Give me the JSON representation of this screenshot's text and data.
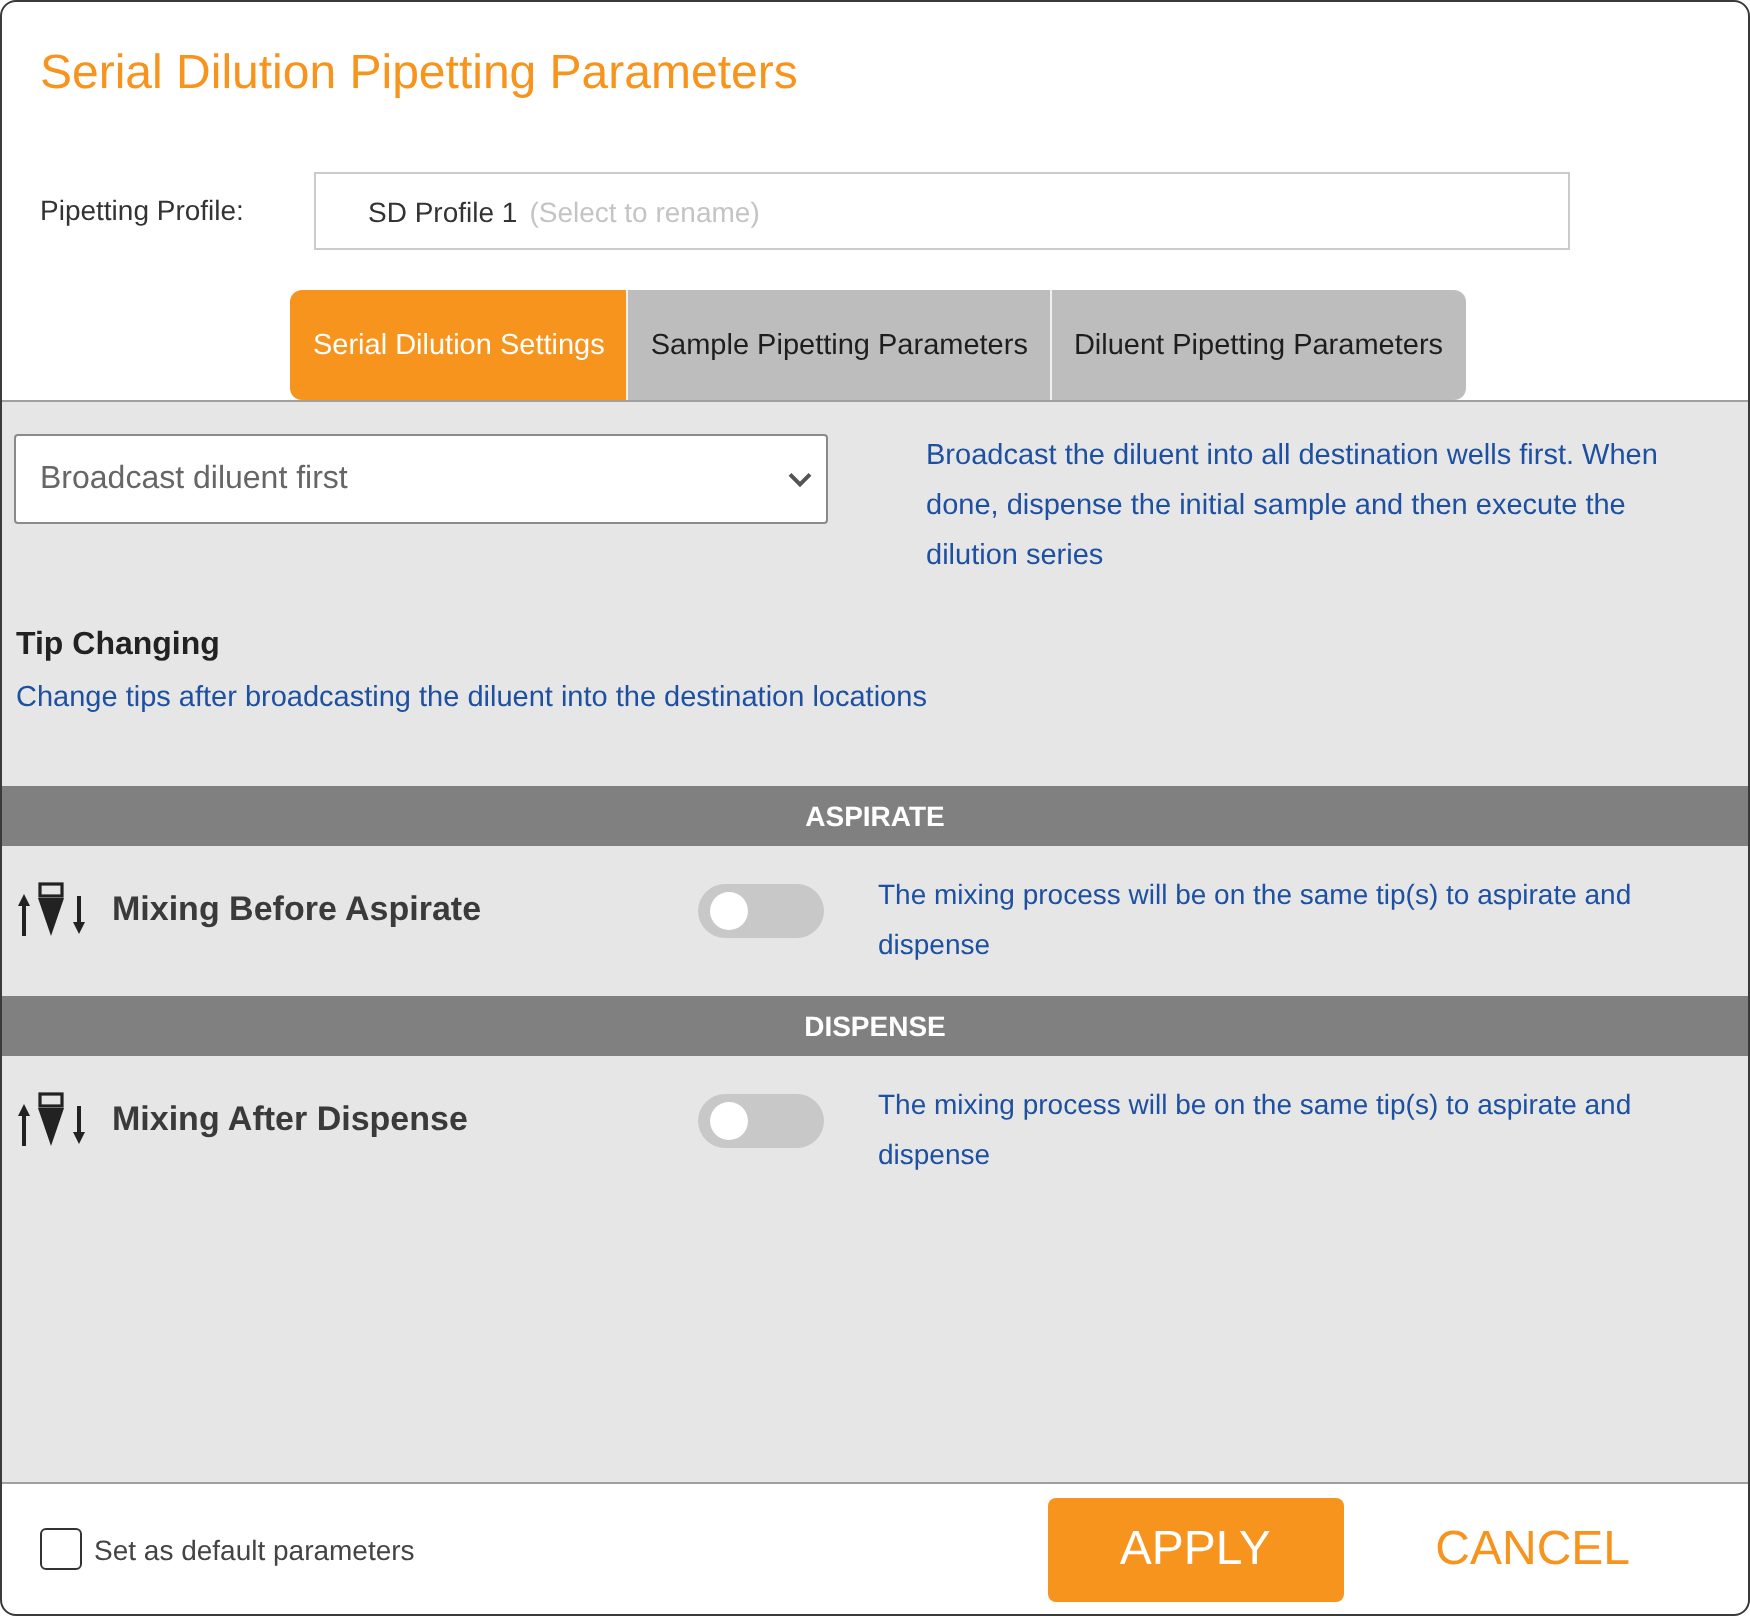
{
  "window": {
    "title": "Serial Dilution Pipetting Parameters"
  },
  "profile": {
    "label": "Pipetting Profile:",
    "value": "SD Profile 1",
    "hint": "(Select to rename)"
  },
  "tabs": [
    {
      "label": "Serial Dilution Settings",
      "selected": true
    },
    {
      "label": "Sample Pipetting Parameters",
      "selected": false
    },
    {
      "label": "Diluent Pipetting Parameters",
      "selected": false
    }
  ],
  "dilution_mode": {
    "value": "Broadcast diluent first",
    "description": "Broadcast the diluent into all destination wells first. When done, dispense the initial sample and then execute the dilution series"
  },
  "tip_changing": {
    "title": "Tip Changing",
    "description": "Change tips after broadcasting the diluent into the destination locations"
  },
  "sections": [
    {
      "title": "ASPIRATE",
      "options": [
        {
          "label": "Mixing Before Aspirate",
          "on": false,
          "description": "The mixing process will be on the same tip(s) to aspirate and dispense"
        }
      ]
    },
    {
      "title": "DISPENSE",
      "options": [
        {
          "label": "Mixing After Dispense",
          "on": false,
          "description": "The mixing process will be on the same tip(s) to aspirate and dispense"
        }
      ]
    }
  ],
  "footer": {
    "default_checkbox": {
      "label": "Set as default parameters",
      "checked": false
    },
    "buttons": [
      {
        "label": "APPLY",
        "kind": "primary"
      },
      {
        "label": "CANCEL",
        "kind": "text"
      }
    ]
  }
}
